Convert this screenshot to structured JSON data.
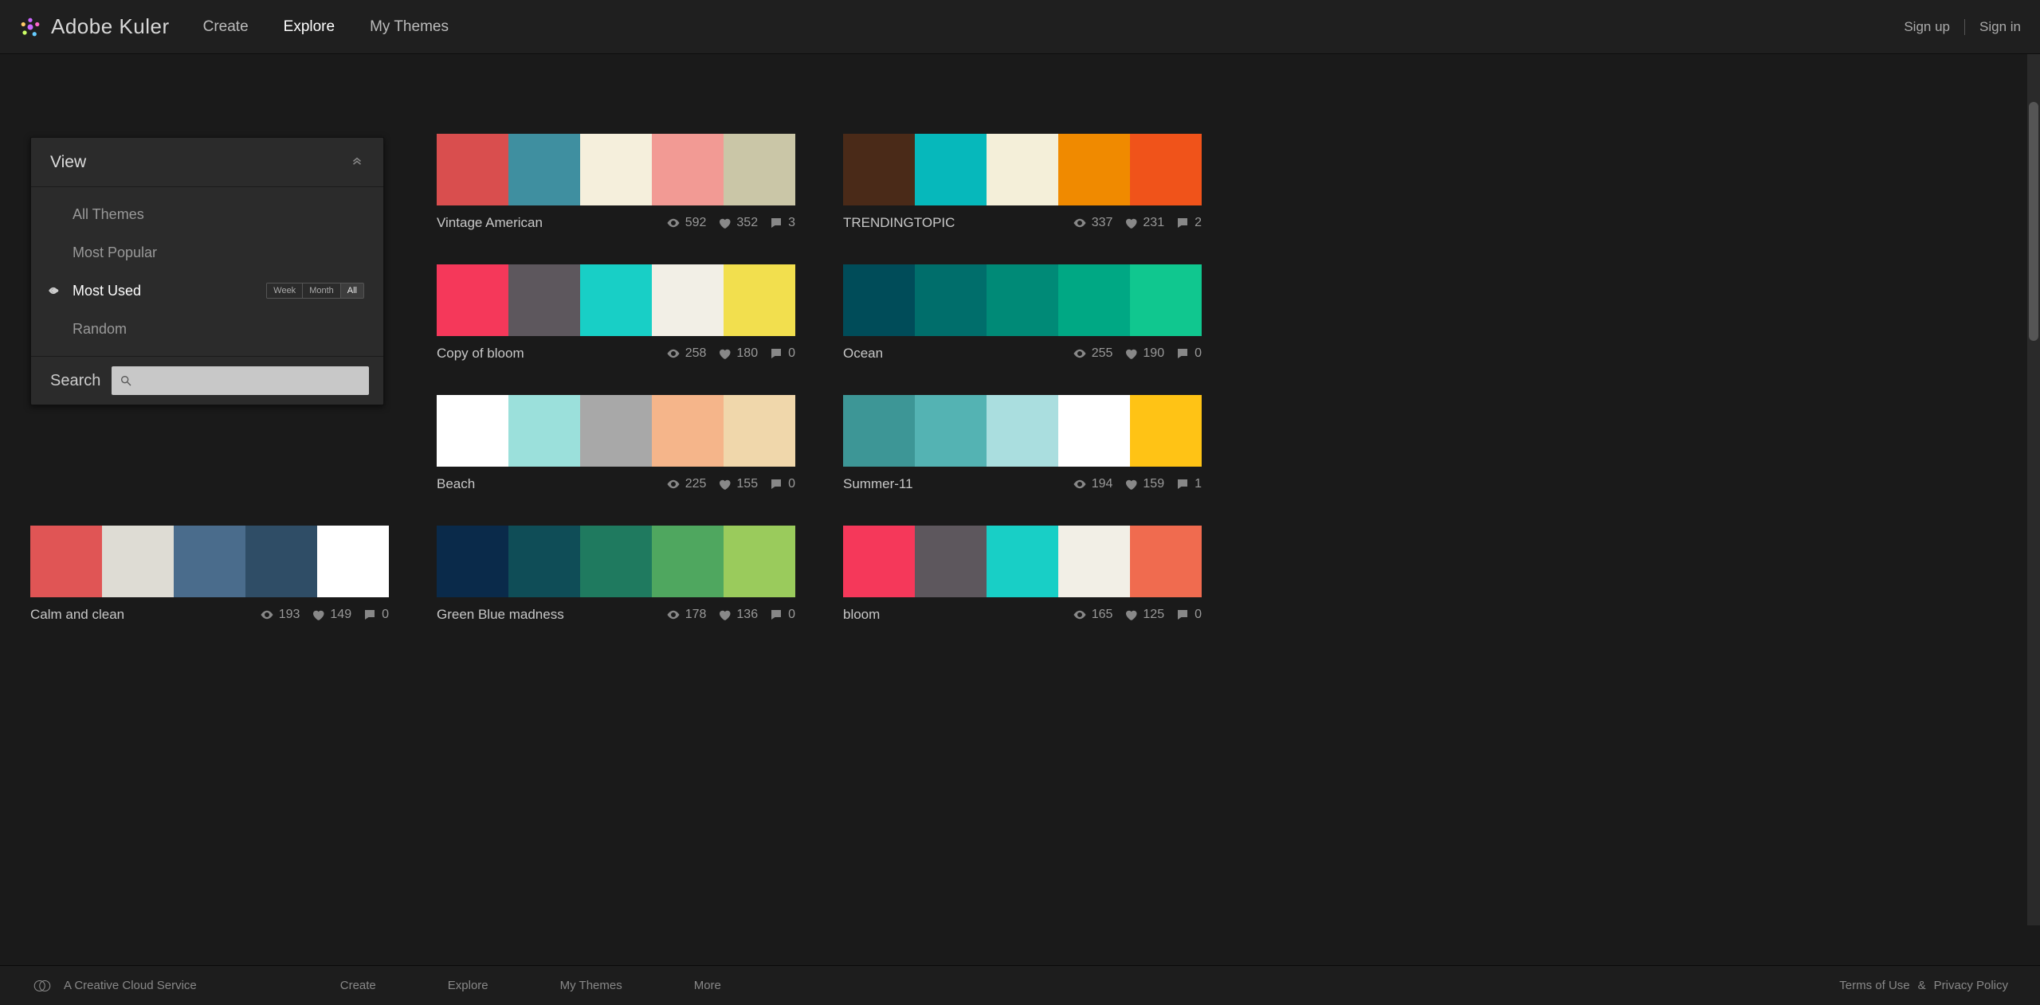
{
  "app": {
    "name": "Adobe Kuler"
  },
  "nav": {
    "create": "Create",
    "explore": "Explore",
    "mythemes": "My Themes",
    "signup": "Sign up",
    "signin": "Sign in"
  },
  "panel": {
    "title": "View",
    "filters": {
      "all_themes": "All Themes",
      "most_popular": "Most Popular",
      "most_used": "Most Used",
      "random": "Random"
    },
    "time": {
      "week": "Week",
      "month": "Month",
      "all": "All"
    },
    "search_label": "Search",
    "search_value": ""
  },
  "icons": {
    "eye": "eye-icon",
    "heart": "heart-icon",
    "comment": "comment-icon",
    "chevron_up": "chevron-up-icon",
    "search": "search-icon",
    "cc": "creative-cloud-icon",
    "logo": "kuler-logo-icon"
  },
  "themes": [
    {
      "name": "Vintage American",
      "colors": [
        "#d94e4e",
        "#3f8fa0",
        "#f5efdc",
        "#f29a94",
        "#cac6a7"
      ],
      "views": "592",
      "likes": "352",
      "comments": "3"
    },
    {
      "name": "TRENDINGTOPIC",
      "colors": [
        "#4a2a18",
        "#06b8bb",
        "#f4efd9",
        "#f08a00",
        "#f0531a"
      ],
      "views": "337",
      "likes": "231",
      "comments": "2"
    },
    {
      "name": "Copy of bloom",
      "colors": [
        "#f5385a",
        "#5d575d",
        "#18cfc6",
        "#f2efe6",
        "#f2df4e"
      ],
      "views": "258",
      "likes": "180",
      "comments": "0"
    },
    {
      "name": "Ocean",
      "colors": [
        "#004c59",
        "#006e6b",
        "#008a77",
        "#00a884",
        "#10c78f"
      ],
      "views": "255",
      "likes": "190",
      "comments": "0"
    },
    {
      "name": "Beach",
      "colors": [
        "#ffffff",
        "#9be0db",
        "#a8a8a8",
        "#f5b58a",
        "#f0d7ab"
      ],
      "views": "225",
      "likes": "155",
      "comments": "0"
    },
    {
      "name": "Summer-11",
      "colors": [
        "#3d9696",
        "#54b3b3",
        "#aadedf",
        "#ffffff",
        "#ffc315"
      ],
      "views": "194",
      "likes": "159",
      "comments": "1"
    },
    {
      "name": "Calm and clean",
      "colors": [
        "#e05555",
        "#dedcd4",
        "#4a6c8c",
        "#2f4d66",
        "#ffffff"
      ],
      "views": "193",
      "likes": "149",
      "comments": "0"
    },
    {
      "name": "Green Blue madness",
      "colors": [
        "#0a2a4a",
        "#0f4d57",
        "#1f7a5f",
        "#4fa75f",
        "#9acb5c"
      ],
      "views": "178",
      "likes": "136",
      "comments": "0"
    },
    {
      "name": "bloom",
      "colors": [
        "#f5385a",
        "#5d575d",
        "#18cfc6",
        "#f2efe6",
        "#f06b4f"
      ],
      "views": "165",
      "likes": "125",
      "comments": "0"
    }
  ],
  "footer": {
    "cc_label": "A Creative Cloud Service",
    "create": "Create",
    "explore": "Explore",
    "mythemes": "My Themes",
    "more": "More",
    "terms": "Terms of Use",
    "amp": "&",
    "privacy": "Privacy Policy"
  }
}
